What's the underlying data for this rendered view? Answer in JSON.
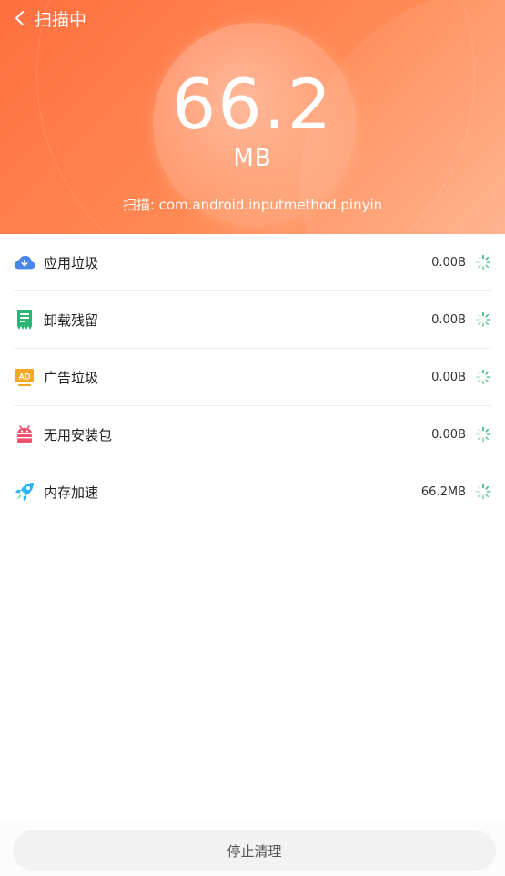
{
  "header": {
    "title": "扫描中",
    "size_value": "66.2",
    "size_unit": "MB",
    "scan_text": "扫描: com.android.inputmethod.pinyin",
    "gradient_colors": [
      "#ff6f3f",
      "#ff8a55",
      "#ffb08a"
    ]
  },
  "items": [
    {
      "label": "应用垃圾",
      "size": "0.00B",
      "icon": "cloud-download-icon",
      "icon_color": "#4a86e8"
    },
    {
      "label": "卸载残留",
      "size": "0.00B",
      "icon": "residue-icon",
      "icon_color": "#2bb673"
    },
    {
      "label": "广告垃圾",
      "size": "0.00B",
      "icon": "ad-icon",
      "icon_color": "#f5a623"
    },
    {
      "label": "无用安装包",
      "size": "0.00B",
      "icon": "android-package-icon",
      "icon_color": "#f0506e"
    },
    {
      "label": "内存加速",
      "size": "66.2MB",
      "icon": "rocket-icon",
      "icon_color": "#29b6f6"
    }
  ],
  "spinner_color": "#2bb673",
  "footer": {
    "stop_label": "停止清理"
  }
}
